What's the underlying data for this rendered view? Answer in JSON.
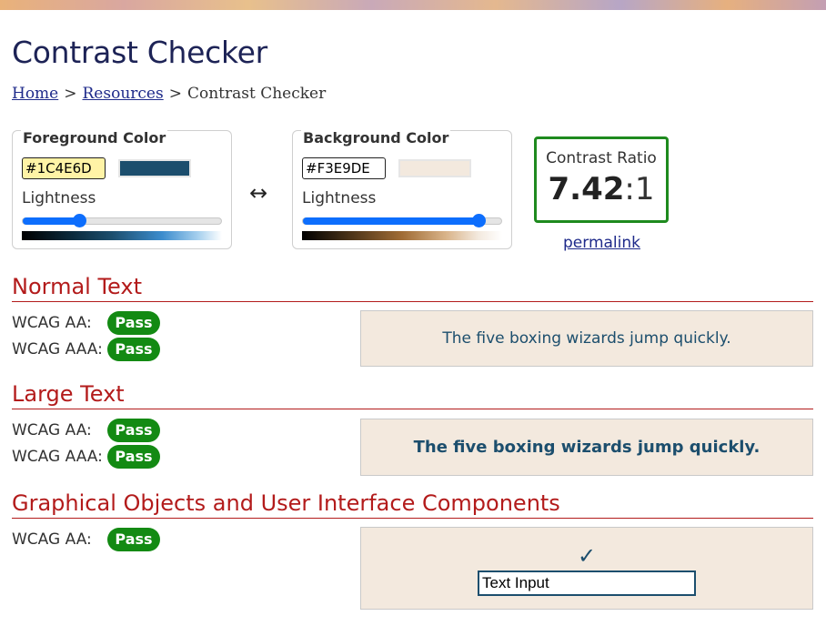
{
  "page": {
    "title": "Contrast Checker"
  },
  "breadcrumb": {
    "home": "Home",
    "resources": "Resources",
    "current": "Contrast Checker",
    "separator": ">"
  },
  "foreground": {
    "legend": "Foreground Color",
    "hex": "#1C4E6D",
    "swatch_color": "#1C4E6D",
    "lightness_label": "Lightness",
    "lightness_fraction": 0.28
  },
  "background": {
    "legend": "Background Color",
    "hex": "#F3E9DE",
    "swatch_color": "#F3E9DE",
    "lightness_label": "Lightness",
    "lightness_fraction": 0.89
  },
  "swap": {
    "icon": "left-right-arrow-icon",
    "glyph": "↔"
  },
  "ratio": {
    "label": "Contrast Ratio",
    "value": "7.42",
    "suffix": ":1",
    "permalink": "permalink",
    "border_color": "#1E8A1E"
  },
  "sections": {
    "normal": {
      "title": "Normal Text",
      "aa_label": "WCAG AA:",
      "aa_result": "Pass",
      "aaa_label": "WCAG AAA:",
      "aaa_result": "Pass",
      "sample": "The five boxing wizards jump quickly."
    },
    "large": {
      "title": "Large Text",
      "aa_label": "WCAG AA:",
      "aa_result": "Pass",
      "aaa_label": "WCAG AAA:",
      "aaa_result": "Pass",
      "sample": "The five boxing wizards jump quickly."
    },
    "graphical": {
      "title": "Graphical Objects and User Interface Components",
      "aa_label": "WCAG AA:",
      "aa_result": "Pass",
      "check_glyph": "✓",
      "input_value": "Text Input"
    }
  },
  "colors": {
    "pass_badge": "#138A13",
    "section_title": "#B31B1B",
    "link": "#1E2A8A",
    "title": "#1D2356"
  }
}
